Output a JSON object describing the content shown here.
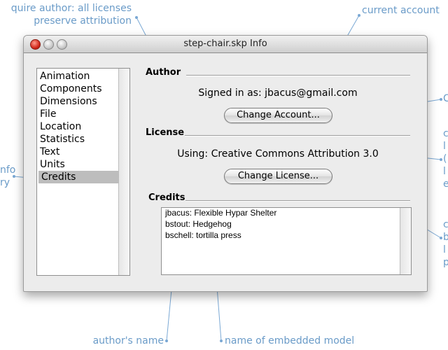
{
  "annotations": {
    "top_left_line1": "quire author: all licenses",
    "top_left_line2": "preserve attribution",
    "current_account": "current account",
    "left_line1": "nfo",
    "left_line2": "ry",
    "right_c1": "C",
    "right_c2": "c",
    "right_l1": "l",
    "right_paren": "(",
    "right_l2": "l",
    "right_e": "e",
    "right_c3": "c",
    "right_b": "b",
    "right_l3": "l",
    "right_p": "p",
    "authors_name": "author's name",
    "embedded_model": "name of embedded model"
  },
  "window": {
    "title": "step-chair.skp Info"
  },
  "sidebar": {
    "items": [
      {
        "label": "Animation",
        "selected": false
      },
      {
        "label": "Components",
        "selected": false
      },
      {
        "label": "Dimensions",
        "selected": false
      },
      {
        "label": "File",
        "selected": false
      },
      {
        "label": "Location",
        "selected": false
      },
      {
        "label": "Statistics",
        "selected": false
      },
      {
        "label": "Text",
        "selected": false
      },
      {
        "label": "Units",
        "selected": false
      },
      {
        "label": "Credits",
        "selected": true
      }
    ]
  },
  "author": {
    "section_title": "Author",
    "signed_in_text": "Signed in as: jbacus@gmail.com",
    "change_button": "Change Account..."
  },
  "license": {
    "section_title": "License",
    "using_text": "Using: Creative Commons Attribution 3.0",
    "change_button": "Change License..."
  },
  "credits": {
    "section_title": "Credits",
    "lines": [
      "jbacus: Flexible Hypar Shelter",
      "bstout: Hedgehog",
      "bschell: tortilla press"
    ]
  },
  "colors": {
    "annotation": "#6a9bc8",
    "window_bg": "#ececec",
    "selection": "#bdbdbd"
  }
}
